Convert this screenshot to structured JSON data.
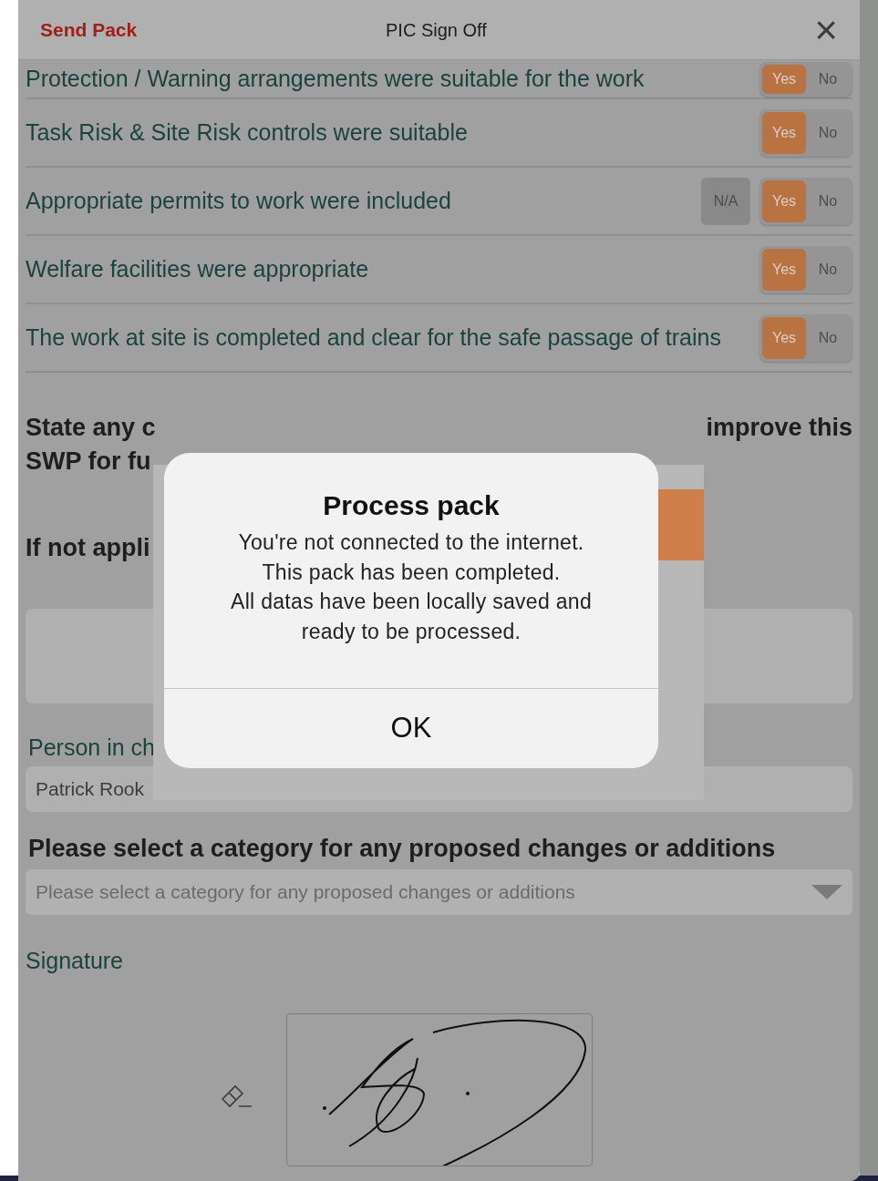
{
  "header": {
    "action": "Send Pack",
    "title": "PIC Sign Off",
    "close": "×"
  },
  "rows": [
    {
      "label": "Protection / Warning arrangements were suitable for the work",
      "options": [
        {
          "label": "Yes",
          "selected": true
        },
        {
          "label": "No",
          "selected": false
        }
      ]
    },
    {
      "label": "Task Risk & Site Risk controls were suitable",
      "options": [
        {
          "label": "Yes",
          "selected": true
        },
        {
          "label": "No",
          "selected": false
        }
      ]
    },
    {
      "label": "Appropriate permits to work were included",
      "na": {
        "label": "N/A",
        "selected": false
      },
      "options": [
        {
          "label": "Yes",
          "selected": true
        },
        {
          "label": "No",
          "selected": false
        }
      ]
    },
    {
      "label": "Welfare facilities were appropriate",
      "options": [
        {
          "label": "Yes",
          "selected": true
        },
        {
          "label": "No",
          "selected": false
        }
      ]
    },
    {
      "label": "The work at site is completed and clear for the safe passage of trains",
      "options": [
        {
          "label": "Yes",
          "selected": true
        },
        {
          "label": "No",
          "selected": false
        }
      ]
    }
  ],
  "changes_heading": {
    "left": "State any c",
    "right": "improve this",
    "line2": "SWP for fu"
  },
  "not_applicable_label": "If not appli",
  "person_label": "Person in ch",
  "person_value": "Patrick Rook",
  "category": {
    "heading": "Please select a category for any proposed changes or additions",
    "placeholder": "Please select a category for any proposed changes or additions"
  },
  "signature_label": "Signature",
  "dialog": {
    "title": "Process pack",
    "message": [
      "You're not connected to the internet.",
      "This pack has been completed.",
      "All datas have been locally saved and",
      "ready to be processed."
    ],
    "button": "OK"
  }
}
